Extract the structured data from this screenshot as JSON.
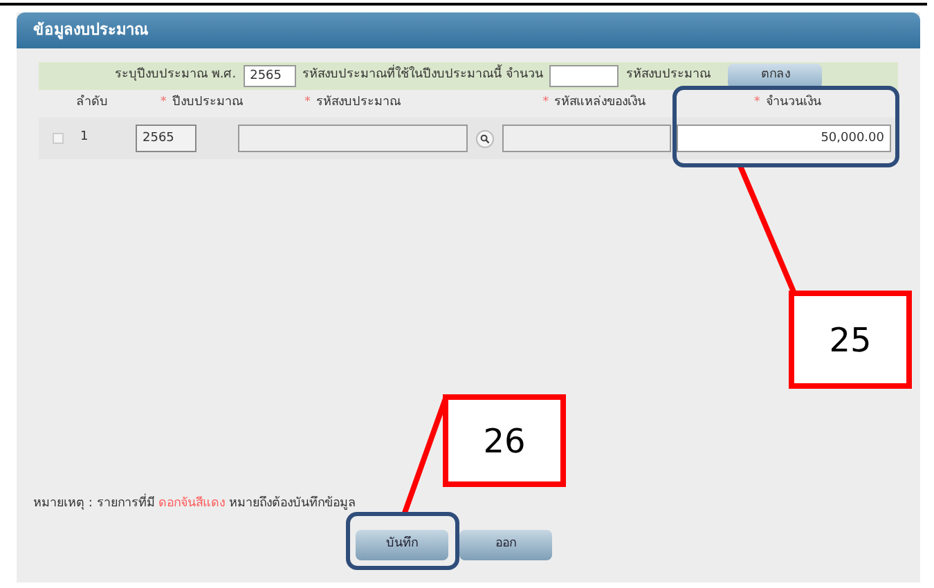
{
  "panel": {
    "title": "ข้อมูลงบประมาณ"
  },
  "filter": {
    "year_label": "ระบุปีงบประมาณ พ.ศ.",
    "year_value": "2565",
    "count_label": "รหัสงบประมาณที่ใช้ในปีงบประมาณนี้ จำนวน",
    "count_suffix": "รหัสงบประมาณ",
    "ok_button": "ตกลง"
  },
  "table": {
    "columns": [
      {
        "label": "ลำดับ",
        "required": false
      },
      {
        "label": "ปีงบประมาณ",
        "required": true
      },
      {
        "label": "รหัสงบประมาณ",
        "required": true
      },
      {
        "label": "รหัสแหล่งของเงิน",
        "required": true
      },
      {
        "label": "จำนวนเงิน",
        "required": true
      }
    ],
    "required_mark": "*",
    "rows": [
      {
        "checked": false,
        "index": "1",
        "year": "2565",
        "amount": "50,000.00"
      }
    ]
  },
  "note": {
    "prefix": "หมายเหตุ : รายการที่มี",
    "highlight": "ดอกจันสีแดง",
    "suffix": "หมายถึงต้องบันทึกข้อมูล"
  },
  "buttons": [
    "บันทึก",
    "ออก"
  ],
  "callouts": [
    {
      "label": "25"
    },
    {
      "label": "26"
    }
  ]
}
